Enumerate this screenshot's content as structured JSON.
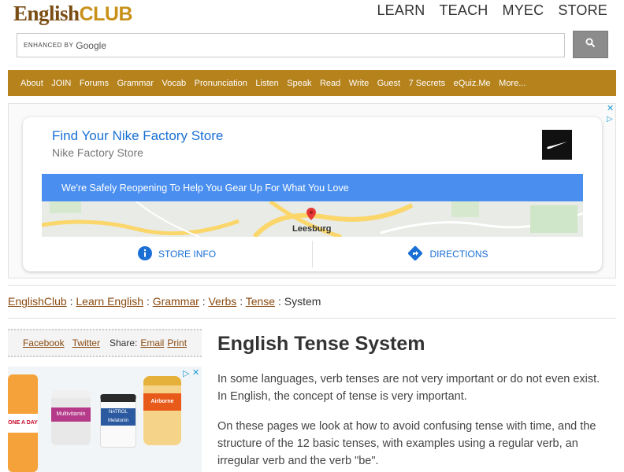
{
  "header": {
    "logo_english": "English",
    "logo_club": "CLUB",
    "topnav": [
      "LEARN",
      "TEACH",
      "MYEC",
      "STORE"
    ]
  },
  "search": {
    "enhanced_label": "ENHANCED BY",
    "google_label": "Google",
    "button_icon": "search-icon"
  },
  "navbar": {
    "items": [
      "About",
      "JOIN",
      "Forums",
      "Grammar",
      "Vocab",
      "Pronunciation",
      "Listen",
      "Speak",
      "Read",
      "Write",
      "Guest",
      "7 Secrets",
      "eQuiz.Me",
      "More..."
    ]
  },
  "ad": {
    "title": "Find Your Nike Factory Store",
    "subtitle": "Nike Factory Store",
    "banner": "We're Safely Reopening To Help You Gear Up For What You Love",
    "map_label": "Leesburg",
    "store_info": "STORE INFO",
    "directions": "DIRECTIONS"
  },
  "breadcrumb": {
    "items": [
      "EnglishClub",
      "Learn English",
      "Grammar",
      "Verbs",
      "Tense"
    ],
    "current": "System",
    "separator": ":"
  },
  "share": {
    "facebook": "Facebook",
    "twitter": "Twitter",
    "share_label": "Share:",
    "email": "Email",
    "print": "Print"
  },
  "sidebar_ad": {
    "products": [
      "ONE A DAY",
      "Multivitamin",
      "NATROL Melatonin",
      "Airborne"
    ]
  },
  "content": {
    "title": "English Tense System",
    "paragraphs": [
      "In some languages, verb tenses are not very important or do not even exist. In English, the concept of tense is very important.",
      "On these pages we look at how to avoid confusing tense with time, and the structure of the 12 basic tenses, with examples using a regular verb, an irregular verb and the verb \"be\"."
    ]
  },
  "colors": {
    "brand_brown": "#7a4d14",
    "brand_gold": "#c8911a",
    "navbar": "#b5821c",
    "link": "#8a4a10",
    "ad_blue": "#1a6fd4"
  }
}
